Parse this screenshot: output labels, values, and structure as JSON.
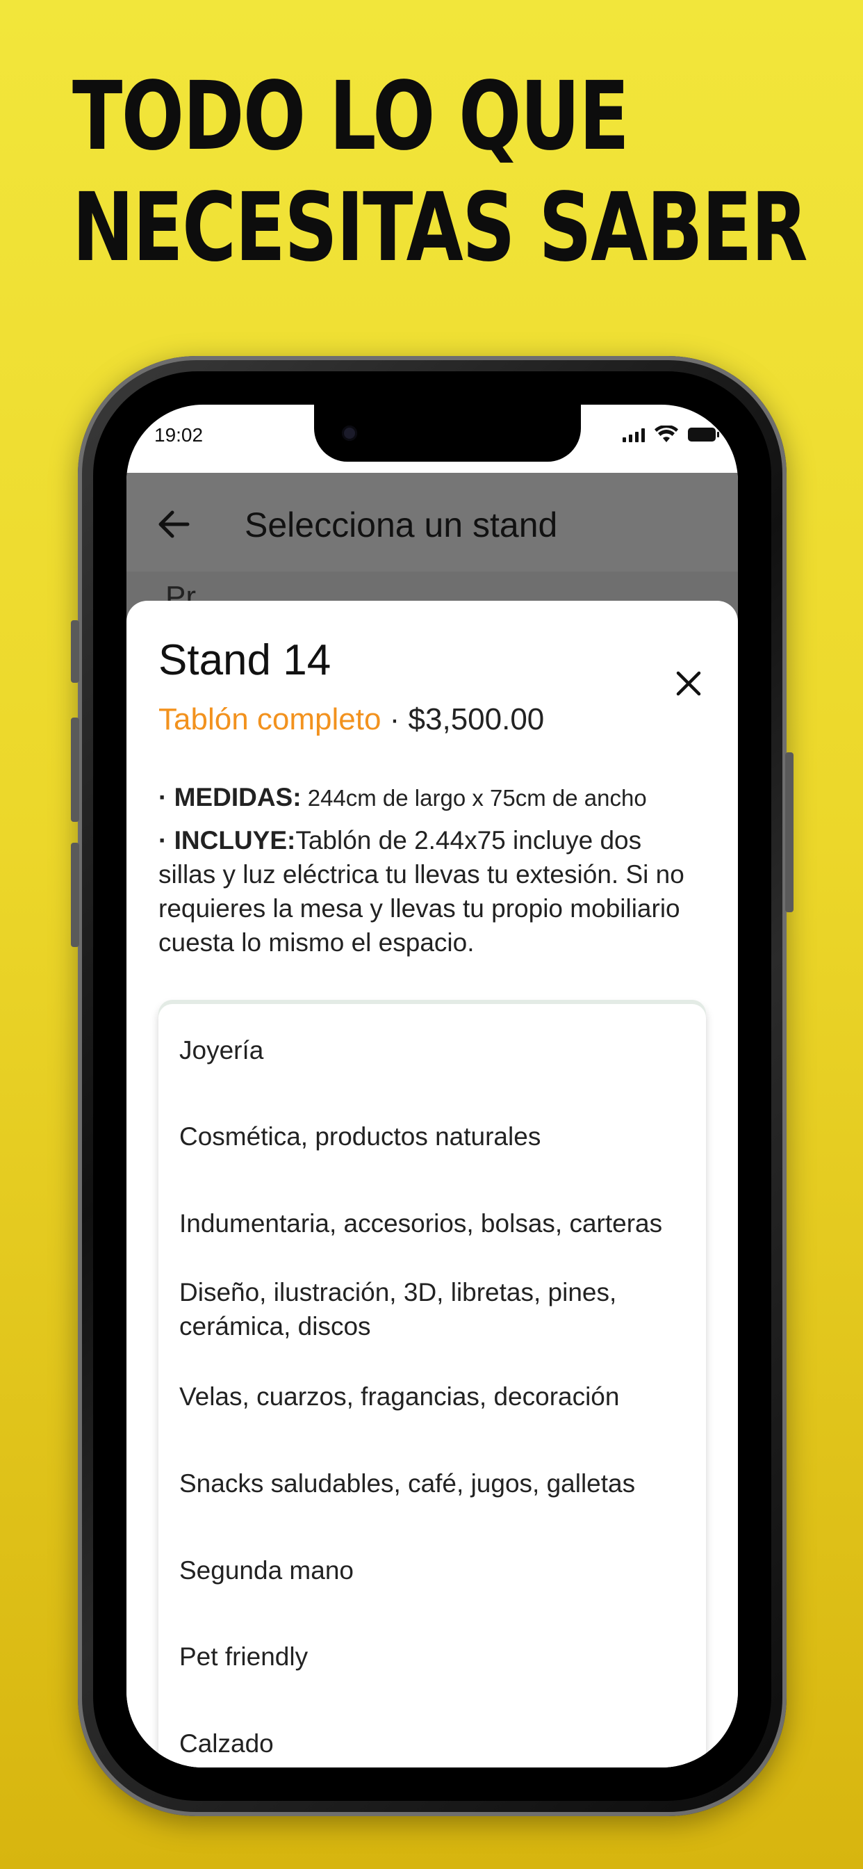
{
  "headline": {
    "line1": "TODO LO QUE",
    "line2": "NECESITAS SABER"
  },
  "status_bar": {
    "time": "19:02"
  },
  "app_bar": {
    "title": "Selecciona un stand"
  },
  "behind_text": "Pr",
  "sheet": {
    "title": "Stand 14",
    "stand_type": "Tablón completo",
    "separator": " · ",
    "price": "$3,500.00",
    "medidas_label": "· MEDIDAS:",
    "medidas_value": " 244cm de largo x 75cm de ancho",
    "incluye_label": "· INCLUYE:",
    "incluye_value": "Tablón de 2.44x75 incluye dos sillas y luz eléctrica tu llevas tu extesión. Si no requieres la mesa y llevas tu propio mobiliario cuesta lo mismo el espacio."
  },
  "category_options": [
    "Joyería",
    "Cosmética, productos naturales",
    "Indumentaria, accesorios, bolsas, carteras",
    "Diseño, ilustración, 3D, libretas, pines, cerámica, discos",
    "Velas, cuarzos, fragancias, decoración",
    "Snacks saludables, café, jugos, galletas",
    "Segunda mano",
    "Pet friendly",
    "Calzado"
  ],
  "colors": {
    "accent_orange": "#f2921e",
    "background_yellow": "#f2e63b",
    "app_bar_gray": "#767676"
  },
  "icons": {
    "back": "arrow-left-icon",
    "close": "close-icon",
    "signal": "signal-icon",
    "wifi": "wifi-icon",
    "battery": "battery-icon"
  }
}
